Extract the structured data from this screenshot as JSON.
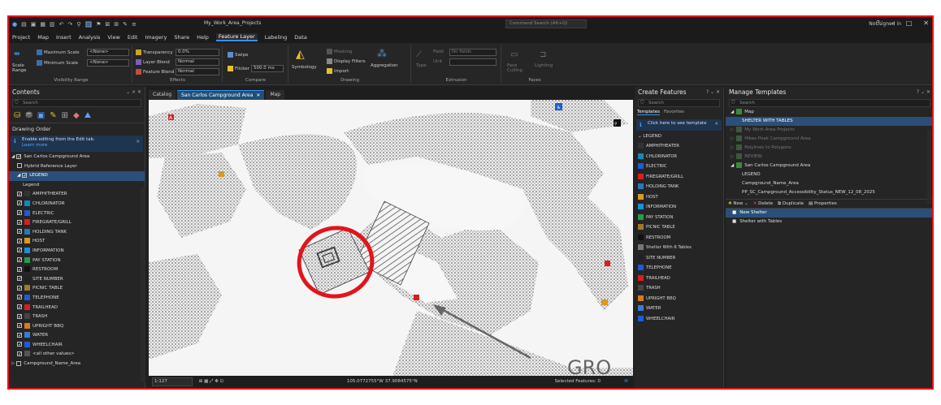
{
  "titlebar": {
    "project_name": "My_Work_Area_Projects",
    "command_search": "Command Search (Alt+Q)",
    "signin": "Not signed in"
  },
  "menu": [
    "Project",
    "Map",
    "Insert",
    "Analysis",
    "View",
    "Edit",
    "Imagery",
    "Share",
    "Help",
    "Feature Layer",
    "Labeling",
    "Data"
  ],
  "menu_active": "Feature Layer",
  "ribbon": {
    "visibility": {
      "label": "Visibility Range",
      "scale_range": "Scale Range",
      "max_scale_label": "Maximum Scale",
      "max_scale_value": "<None>",
      "min_scale_label": "Minimum Scale",
      "min_scale_value": "<None>"
    },
    "effects": {
      "label": "Effects",
      "transparency_label": "Transparency",
      "transparency_value": "0.0%",
      "layer_blend_label": "Layer Blend",
      "layer_blend_value": "Normal",
      "feature_blend_label": "Feature Blend",
      "feature_blend_value": "Normal"
    },
    "compare": {
      "label": "Compare",
      "swipe": "Swipe",
      "flicker": "Flicker",
      "flicker_value": "500.0",
      "flicker_unit": "ms"
    },
    "drawing": {
      "label": "Drawing",
      "symbology": "Symbology",
      "masking": "Masking",
      "display_filters": "Display Filters",
      "import": "Import",
      "aggregation": "Aggregation"
    },
    "extrusion": {
      "label": "Extrusion",
      "type": "Type",
      "field": "Field",
      "field_value": "No fields",
      "unit": "Unit"
    },
    "faces": {
      "label": "Faces",
      "face_culling": "Face Culling",
      "lighting": "Lighting"
    }
  },
  "contents": {
    "title": "Contents",
    "search": "Search",
    "section": "Drawing Order",
    "info_text": "Enable editing from the Edit tab.",
    "info_link": "Learn more",
    "items": [
      {
        "label": "San Carlos Campground Area",
        "level": 0,
        "checked": true
      },
      {
        "label": "Hybrid Reference Layer",
        "level": 1,
        "checked": false
      },
      {
        "label": "LEGEND",
        "level": 1,
        "checked": true,
        "selected": true
      },
      {
        "label": "Legend",
        "level": 2,
        "checked": null
      }
    ],
    "legend_items": [
      "AMPHITHEATER",
      "CHLORINATOR",
      "ELECTRIC",
      "FIREGRATE/GRILL",
      "HOLDING TANK",
      "HOST",
      "INFORMATION",
      "PAY STATION",
      "RESTROOM",
      "SITE NUMBER",
      "PICNIC TABLE",
      "TELEPHONE",
      "TRAILHEAD",
      "TRASH",
      "UPRIGHT BBQ",
      "WATER",
      "WHEELCHAIR",
      "<all other values>"
    ],
    "last_item": "Campground_Name_Area"
  },
  "view_tabs": [
    "Catalog",
    "San Carlos Campground Area",
    "Map"
  ],
  "view_tab_active": "San Carlos Campground Area",
  "map": {
    "scale": "1:127",
    "coords": "105.0772755°W 37.9084575°N",
    "selected": "Selected Features: 0",
    "map_text": "GRO"
  },
  "create": {
    "title": "Create Features",
    "search": "Search",
    "tabs": [
      "Templates",
      "Favorites"
    ],
    "info": "Click here to see template",
    "group": "LEGEND",
    "items": [
      "AMPHITHEATER",
      "CHLORINATOR",
      "ELECTRIC",
      "FIREGRATE/GRILL",
      "HOLDING TANK",
      "HOST",
      "INFORMATION",
      "PAY STATION",
      "PICNIC TABLE",
      "RESTROOM",
      "Shelter With 6 Tables",
      "SITE NUMBER",
      "TELEPHONE",
      "TRAILHEAD",
      "TRASH",
      "UPRIGHT BBQ",
      "WATER",
      "WHEELCHAIR"
    ]
  },
  "manage": {
    "title": "Manage Templates",
    "search": "Search",
    "tree": [
      {
        "label": "Map",
        "level": 0,
        "dim": false
      },
      {
        "label": "SHELTER WITH TABLES",
        "level": 1,
        "dim": false,
        "selected": true
      },
      {
        "label": "My Work Area Projects",
        "level": 0,
        "dim": true
      },
      {
        "label": "Hikes Peak Campground Area",
        "level": 0,
        "dim": true
      },
      {
        "label": "Polylines to Polygons",
        "level": 0,
        "dim": true
      },
      {
        "label": "REVIEW",
        "level": 0,
        "dim": true
      },
      {
        "label": "San Carlos Campground Area",
        "level": 0,
        "dim": false
      },
      {
        "label": "LEGEND",
        "level": 1,
        "dim": false
      },
      {
        "label": "Campground_Name_Area",
        "level": 1,
        "dim": false
      },
      {
        "label": "PP_SC_Campground_Accessibility_Status_NEW_12_08_2025",
        "level": 1,
        "dim": false
      }
    ],
    "toolbar": {
      "new": "New",
      "delete": "Delete",
      "duplicate": "Duplicate",
      "properties": "Properties"
    },
    "list": [
      {
        "label": "New Shelter",
        "selected": true
      },
      {
        "label": "Shelter with Tables",
        "selected": false
      }
    ]
  },
  "colors": {
    "accent": "#3c8ee7",
    "selection": "#2b4f78",
    "annotation": "#e3141b"
  }
}
